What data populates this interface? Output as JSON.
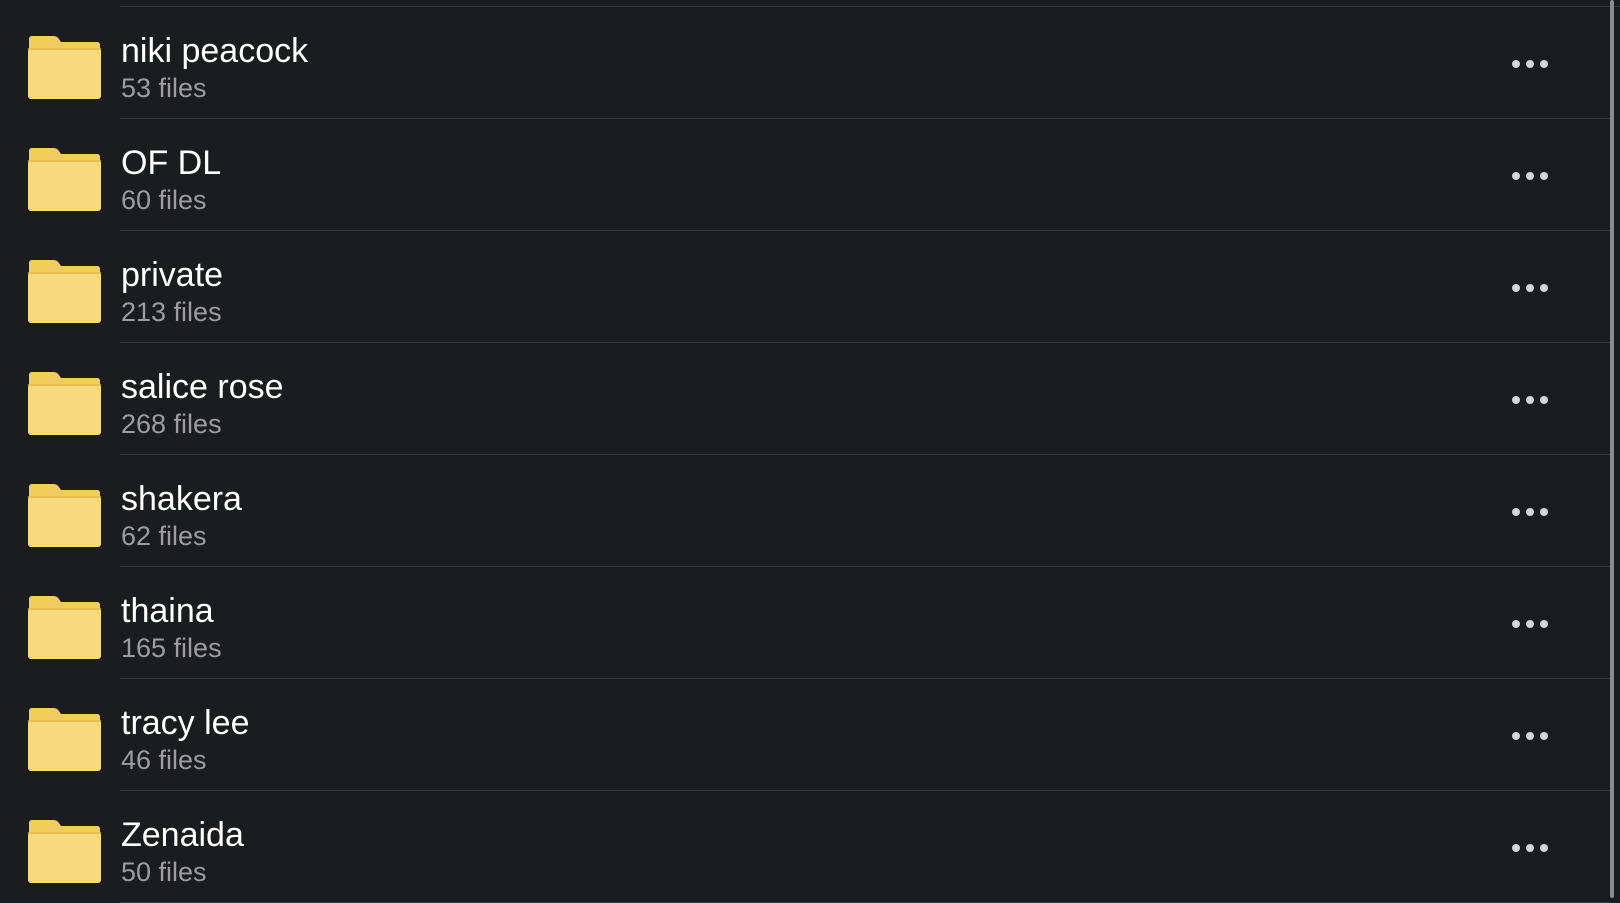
{
  "folders": [
    {
      "name": "niki peacock",
      "count": "53 files"
    },
    {
      "name": "OF DL",
      "count": "60 files"
    },
    {
      "name": "private",
      "count": "213 files"
    },
    {
      "name": "salice rose",
      "count": "268 files"
    },
    {
      "name": "shakera",
      "count": "62 files"
    },
    {
      "name": "thaina",
      "count": "165 files"
    },
    {
      "name": "tracy lee",
      "count": "46 files"
    },
    {
      "name": "Zenaida",
      "count": "50 files"
    }
  ],
  "icons": {
    "folder": "folder-icon",
    "more": "more-options-icon"
  },
  "colors": {
    "background": "#1b1c1e",
    "folder_fill": "#f7da7e",
    "folder_tab": "#f3cd5c",
    "name_text": "#ffffff",
    "count_text": "#9c9ca2"
  }
}
